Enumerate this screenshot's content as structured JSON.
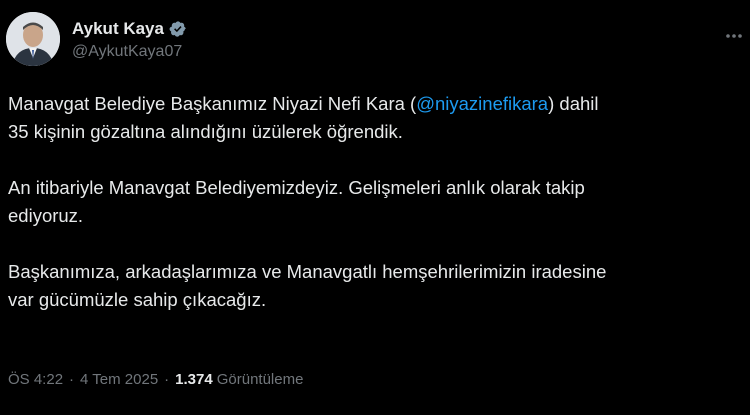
{
  "author": {
    "name": "Aykut Kaya",
    "handle": "@AykutKaya07",
    "verified": true
  },
  "tweet": {
    "line1_before": "Manavgat Belediye Başkanımız Niyazi Nefi Kara (",
    "mention": "@niyazinefikara",
    "line1_after": ") dahil",
    "line2": "35 kişinin gözaltına alındığını üzülerek öğrendik.",
    "para2_line1": "An itibariyle Manavgat Belediyemizdeyiz. Gelişmeleri anlık olarak takip",
    "para2_line2": "ediyoruz.",
    "para3_line1": "Başkanımıza, arkadaşlarımıza ve Manavgatlı hemşehrilerimizin iradesine",
    "para3_line2": "var gücümüzle sahip çıkacağız."
  },
  "meta": {
    "time": "ÖS 4:22",
    "date": "4 Tem 2025",
    "views_count": "1.374",
    "views_label": "Görüntüleme",
    "separator": "·"
  },
  "icons": {
    "verified": "verified-badge-icon",
    "more": "more-options-icon"
  },
  "colors": {
    "background": "#000000",
    "text": "#e7e9ea",
    "muted": "#71767b",
    "link": "#1d9bf0"
  }
}
